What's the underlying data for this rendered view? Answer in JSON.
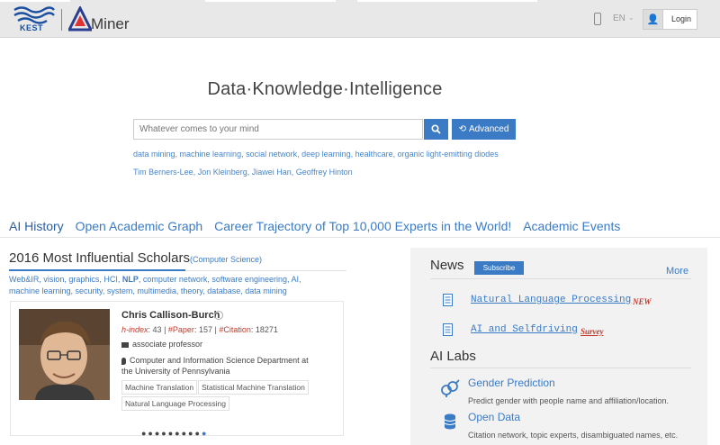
{
  "header": {
    "logo_text": "KEST",
    "brand": "Miner",
    "language": "EN",
    "login_label": "Login"
  },
  "hero": {
    "tagline": "Data·Knowledge·Intelligence",
    "search_placeholder": "Whatever comes to your mind",
    "advanced_label": "Advanced",
    "topics": "data mining, machine learning, social network, deep learning, healthcare, organic light-emitting diodes",
    "people": "Tim Berners-Lee, Jon Kleinberg, Jiawei Han, Geoffrey Hinton"
  },
  "tabs": [
    "AI History",
    "Open Academic Graph",
    "Career Trajectory of Top 10,000 Experts in the World!",
    "Academic Events"
  ],
  "scholars": {
    "title": "2016 Most Influential Scholars",
    "subtitle": "(Computer Science)",
    "fields_part1": "Web&IR, vision, graphics, HCI, ",
    "fields_bold": "NLP",
    "fields_part2": ", computer network, software engineering, AI, machine learning, security, system, multimedia, theory, database, data mining",
    "card": {
      "name": "Chris Callison-Burch",
      "hindex_label": "h-index",
      "hindex": "43",
      "paper_label": "#Paper",
      "paper": "157",
      "citation_label": "#Citation",
      "citation": "18271",
      "position": "associate professor",
      "affiliation": "Computer and Information Science Department at the University of Pennsylvania",
      "tags": [
        "Machine Translation",
        "Statistical Machine Translation",
        "Natural Language Processing"
      ]
    },
    "dots": "●●●●●●●●●",
    "active_dot": "●"
  },
  "news": {
    "title": "News",
    "subscribe_label": "Subscribe",
    "more_label": "More",
    "items": [
      {
        "title": "Natural Language Processing",
        "badge": "NEW"
      },
      {
        "title": "AI and Selfdriving",
        "badge": "Survey"
      }
    ]
  },
  "ailabs": {
    "title": "AI Labs",
    "items": [
      {
        "title": "Gender Prediction",
        "desc": "Predict gender with people name and affiliation/location."
      },
      {
        "title": "Open Data",
        "desc": "Citation network, topic experts, disambiguated names, etc."
      }
    ]
  },
  "colors": {
    "accent": "#3b7bc6",
    "badge": "#c0392b",
    "panel": "#f2f2f2",
    "topbar": "#e8e8e8"
  },
  "icons": [
    "wave-logo-icon",
    "aminer-logo-icon",
    "mobile-phone-icon",
    "user-icon",
    "search-icon",
    "refresh-icon",
    "briefcase-icon",
    "map-pin-icon",
    "check-circle-icon",
    "document-icon",
    "gender-icon",
    "database-icon"
  ]
}
